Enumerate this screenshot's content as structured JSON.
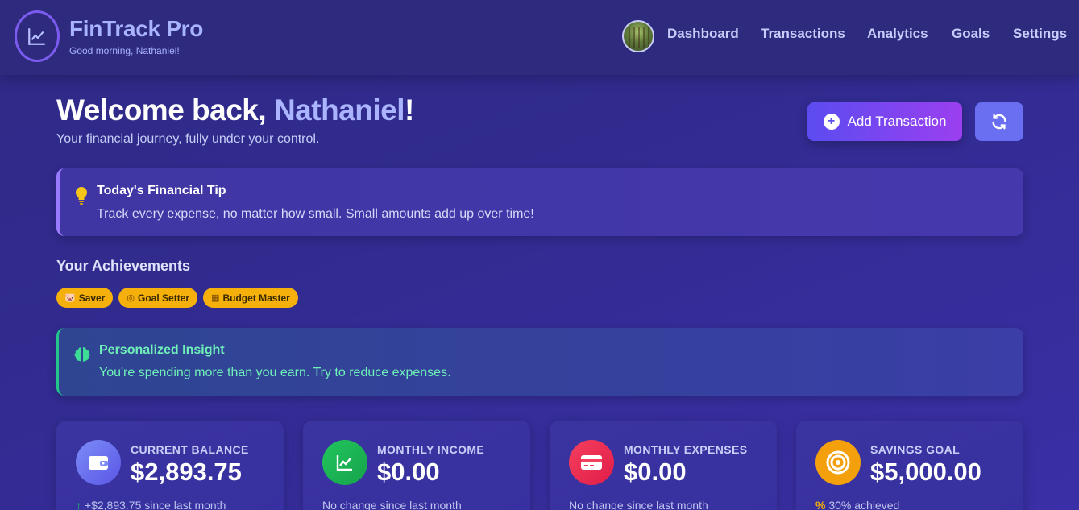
{
  "header": {
    "brand_title": "FinTrack Pro",
    "brand_subtitle": "Good morning, Nathaniel!",
    "nav": [
      "Dashboard",
      "Transactions",
      "Analytics",
      "Goals",
      "Settings"
    ]
  },
  "welcome": {
    "prefix": "Welcome back, ",
    "name": "Nathaniel",
    "suffix": "!",
    "tagline": "Your financial journey, fully under your control."
  },
  "actions": {
    "add_label": "Add Transaction",
    "add_icon": "plus-circle-icon",
    "refresh_icon": "refresh-icon"
  },
  "tip": {
    "icon": "lightbulb-icon",
    "title": "Today's Financial Tip",
    "text": "Track every expense, no matter how small. Small amounts add up over time!"
  },
  "achievements": {
    "heading": "Your Achievements",
    "badges": [
      {
        "icon": "piggy-bank-icon",
        "glyph": "🐷",
        "label": "Saver"
      },
      {
        "icon": "target-icon",
        "glyph": "◎",
        "label": "Goal Setter"
      },
      {
        "icon": "calculator-icon",
        "glyph": "▦",
        "label": "Budget Master"
      }
    ]
  },
  "insight": {
    "icon": "brain-icon",
    "title": "Personalized Insight",
    "text": "You're spending more than you earn. Try to reduce expenses."
  },
  "stats": [
    {
      "icon": "wallet-icon",
      "label": "CURRENT BALANCE",
      "value": "$2,893.75",
      "note_prefix": "↑",
      "note": "+$2,893.75 since last month"
    },
    {
      "icon": "chart-line-icon",
      "label": "MONTHLY INCOME",
      "value": "$0.00",
      "note_prefix": "",
      "note": "No change since last month"
    },
    {
      "icon": "credit-card-icon",
      "label": "MONTHLY EXPENSES",
      "value": "$0.00",
      "note_prefix": "",
      "note": "No change since last month"
    },
    {
      "icon": "bullseye-icon",
      "label": "SAVINGS GOAL",
      "value": "$5,000.00",
      "note_prefix": "%",
      "note": "30% achieved"
    }
  ],
  "colors": {
    "background": "#312b8f",
    "accent": "#aab4ff",
    "badge": "#f5b00b",
    "insight": "#6ff0b8"
  }
}
